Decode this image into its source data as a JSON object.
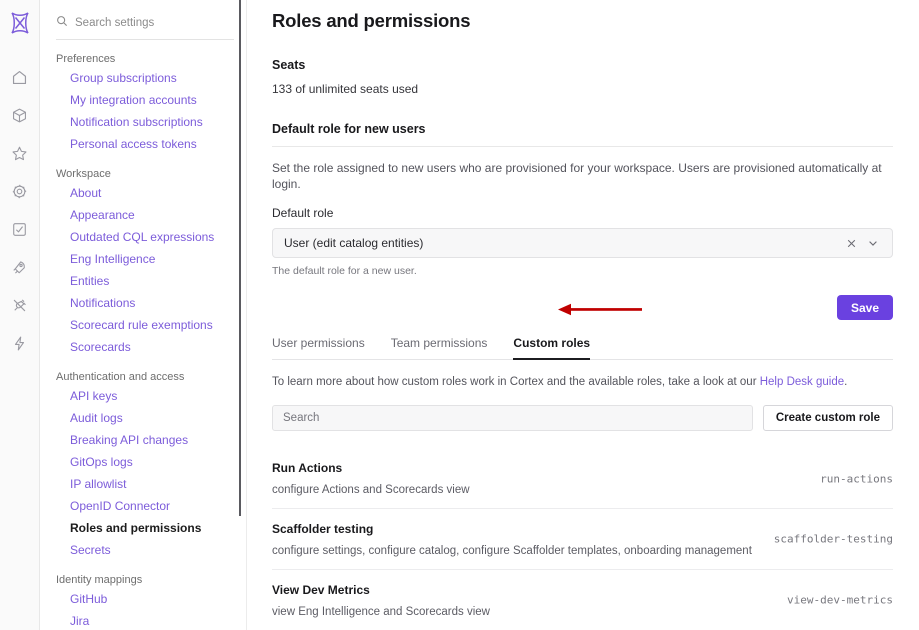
{
  "rail": {
    "logo_name": "cortex-logo",
    "items": [
      {
        "icon": "home-icon",
        "label": "Home"
      },
      {
        "icon": "cube-icon",
        "label": "Catalog"
      },
      {
        "icon": "star-icon",
        "label": "Favorites"
      },
      {
        "icon": "gear-icon",
        "label": "Settings"
      },
      {
        "icon": "scorecard-icon",
        "label": "Scorecards"
      },
      {
        "icon": "rocket-icon",
        "label": "Initiatives"
      },
      {
        "icon": "plug-icon",
        "label": "Integrations"
      },
      {
        "icon": "lightning-icon",
        "label": "Actions"
      }
    ]
  },
  "nav": {
    "search": {
      "placeholder": "Search settings",
      "value": "",
      "icon": "search-icon"
    },
    "groups": [
      {
        "title": "Preferences",
        "items": [
          {
            "label": "Group subscriptions",
            "active": false
          },
          {
            "label": "My integration accounts",
            "active": false
          },
          {
            "label": "Notification subscriptions",
            "active": false
          },
          {
            "label": "Personal access tokens",
            "active": false
          }
        ]
      },
      {
        "title": "Workspace",
        "items": [
          {
            "label": "About",
            "active": false
          },
          {
            "label": "Appearance",
            "active": false
          },
          {
            "label": "Outdated CQL expressions",
            "active": false
          },
          {
            "label": "Eng Intelligence",
            "active": false
          },
          {
            "label": "Entities",
            "active": false
          },
          {
            "label": "Notifications",
            "active": false
          },
          {
            "label": "Scorecard rule exemptions",
            "active": false
          },
          {
            "label": "Scorecards",
            "active": false
          }
        ]
      },
      {
        "title": "Authentication and access",
        "items": [
          {
            "label": "API keys",
            "active": false
          },
          {
            "label": "Audit logs",
            "active": false
          },
          {
            "label": "Breaking API changes",
            "active": false
          },
          {
            "label": "GitOps logs",
            "active": false
          },
          {
            "label": "IP allowlist",
            "active": false
          },
          {
            "label": "OpenID Connector",
            "active": false
          },
          {
            "label": "Roles and permissions",
            "active": true
          },
          {
            "label": "Secrets",
            "active": false
          }
        ]
      },
      {
        "title": "Identity mappings",
        "items": [
          {
            "label": "GitHub",
            "active": false
          },
          {
            "label": "Jira",
            "active": false
          }
        ]
      }
    ]
  },
  "main": {
    "page_title": "Roles and permissions",
    "seats": {
      "heading": "Seats",
      "line": "133 of unlimited  seats used"
    },
    "default_role_section": {
      "heading": "Default role for new users",
      "description": "Set the role assigned to new users who are provisioned for your workspace. Users are provisioned automatically at login.",
      "field_label": "Default role",
      "selected_value": "User (edit catalog entities)",
      "clear_icon": "close-icon",
      "chevron_icon": "chevron-down-icon",
      "help_text": "The default role for a new user.",
      "save_label": "Save"
    },
    "tabs": [
      {
        "label": "User permissions",
        "active": false
      },
      {
        "label": "Team permissions",
        "active": false
      },
      {
        "label": "Custom roles",
        "active": true
      }
    ],
    "learn_more": {
      "text": "To learn more about how custom roles work in Cortex and the available roles, take a look at our ",
      "link_label": "Help Desk guide",
      "trailing": "."
    },
    "role_search": {
      "placeholder": "Search",
      "value": ""
    },
    "create_button": "Create custom role",
    "roles": [
      {
        "name": "Run Actions",
        "description": "configure Actions and Scorecards view",
        "slug": "run-actions"
      },
      {
        "name": "Scaffolder testing",
        "description": "configure settings, configure catalog, configure Scaffolder templates, onboarding management …",
        "slug": "scaffolder-testing"
      },
      {
        "name": "View Dev Metrics",
        "description": "view Eng Intelligence and Scorecards view",
        "slug": "view-dev-metrics"
      }
    ]
  },
  "annotation": {
    "arrow_color": "#c00000",
    "arrow_name": "red-annotation-arrow"
  },
  "colors": {
    "accent_purple": "#7c5cda",
    "save_button": "#6a41e0",
    "annotation_red": "#c00000"
  }
}
